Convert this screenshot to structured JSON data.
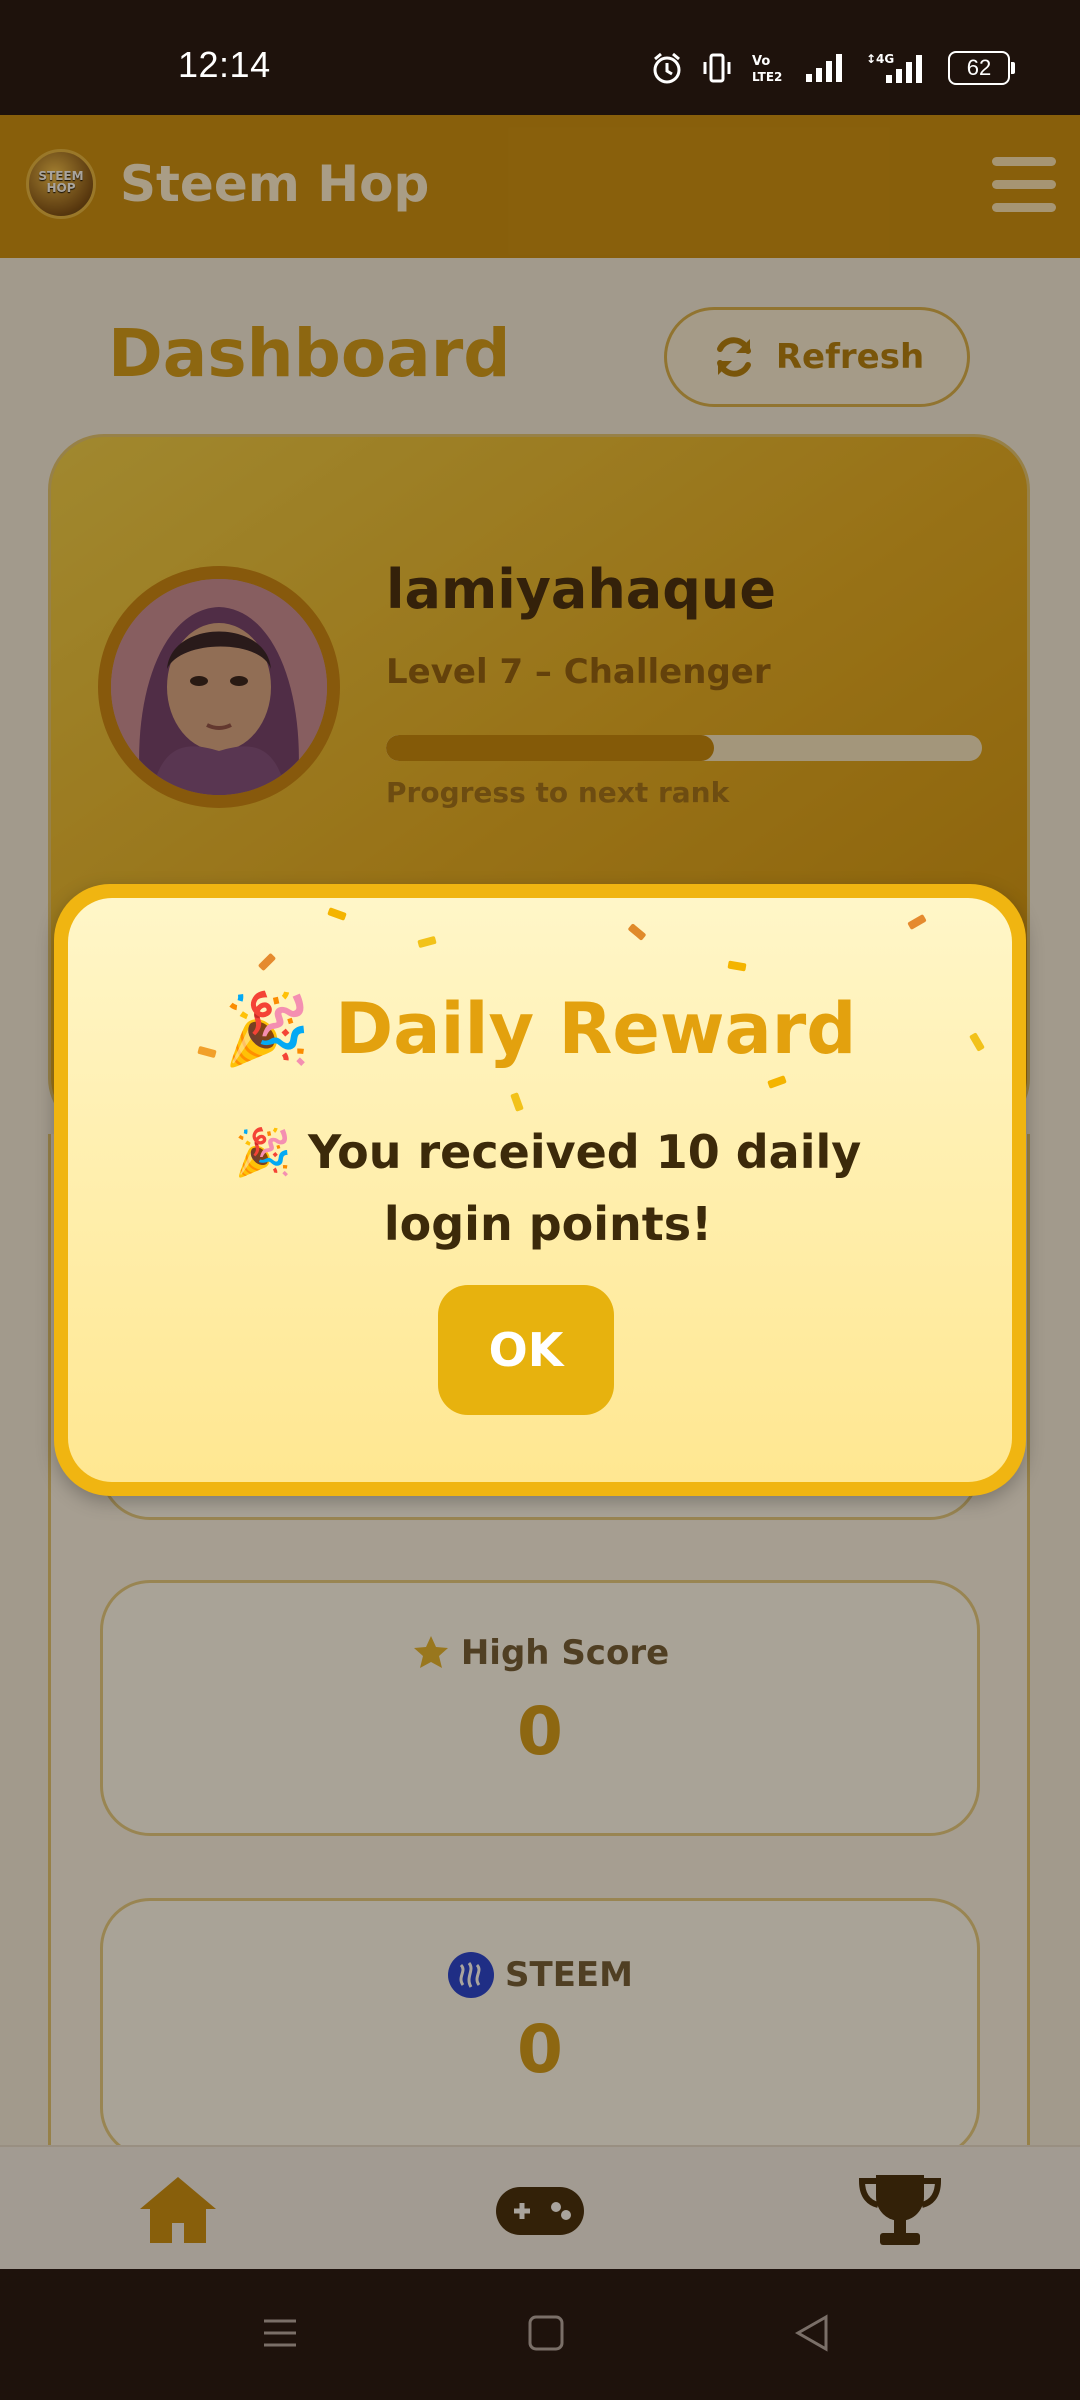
{
  "status_bar": {
    "time": "12:14",
    "battery": "62"
  },
  "app": {
    "title": "Steem Hop",
    "logo_text": "STEEM HOP"
  },
  "dashboard": {
    "title": "Dashboard",
    "refresh_label": "Refresh",
    "profile": {
      "username": "lamiyahaque",
      "level": "Level 7 – Challenger",
      "progress_label": "Progress to next rank",
      "progress": 0.55
    },
    "stats": [
      {
        "label": "High Score",
        "value": "0",
        "icon": "star-icon"
      },
      {
        "label": "STEEM",
        "value": "0",
        "icon": "steem-icon"
      }
    ]
  },
  "modal": {
    "title": "Daily Reward",
    "message": "You received 10 daily login points!",
    "ok_label": "OK"
  },
  "bottom_nav": [
    "home-icon",
    "gamepad-icon",
    "trophy-icon"
  ],
  "colors": {
    "accent": "#c98d0d",
    "gold": "#d19a16",
    "dark": "#1e120c"
  }
}
